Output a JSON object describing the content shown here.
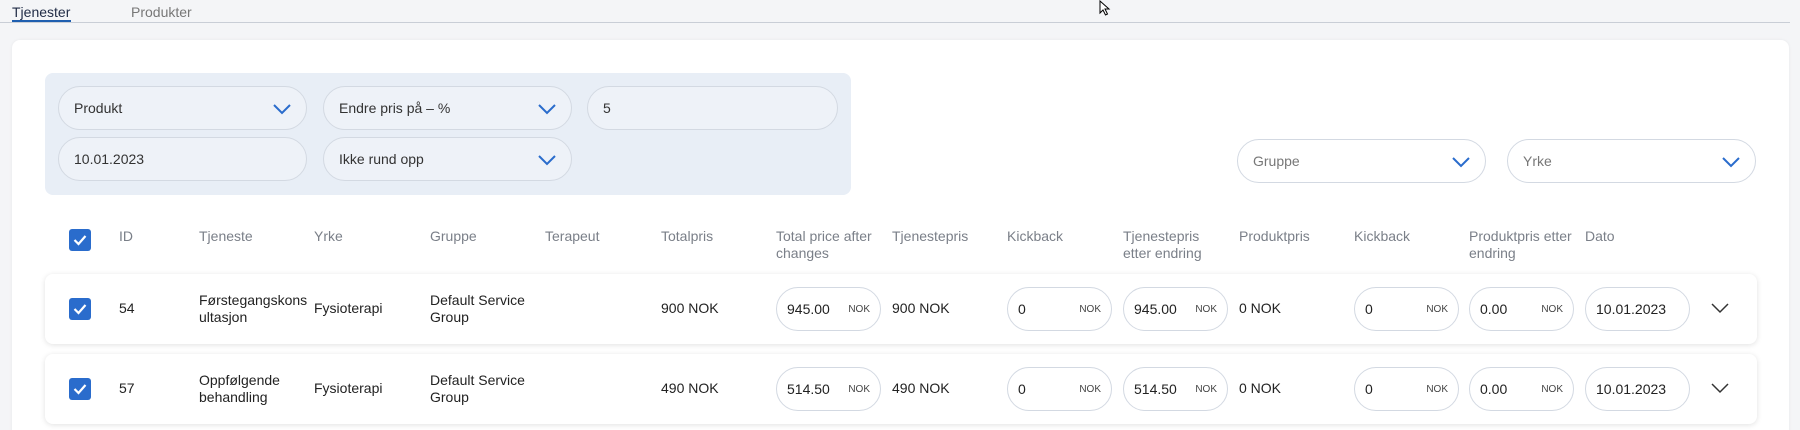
{
  "tabs": [
    {
      "label": "Tjenester",
      "active": true
    },
    {
      "label": "Produkter",
      "active": false
    }
  ],
  "filters": {
    "type_select": "Produkt",
    "price_mode_select": "Endre pris på – %",
    "percent_value": "5",
    "date_value": "10.01.2023",
    "rounding_select": "Ikke rund opp"
  },
  "right_filters": {
    "group_placeholder": "Gruppe",
    "profession_placeholder": "Yrke"
  },
  "table": {
    "headers": {
      "id": "ID",
      "service": "Tjeneste",
      "profession": "Yrke",
      "group": "Gruppe",
      "therapist": "Terapeut",
      "total_price": "Totalpris",
      "total_after_l1": "Total price after",
      "total_after_l2": "changes",
      "service_price": "Tjenestepris",
      "kickback": "Kickback",
      "service_after_l1": "Tjenestepris",
      "service_after_l2": "etter endring",
      "product_price": "Produktpris",
      "kickback2": "Kickback",
      "product_after_l1": "Produktpris etter",
      "product_after_l2": "endring",
      "date": "Dato"
    },
    "rows": [
      {
        "checked": true,
        "id": "54",
        "service_l1": "Førstegangskons",
        "service_l2": "ultasjon",
        "profession": "Fysioterapi",
        "group_l1": "Default Service",
        "group_l2": "Group",
        "total_price": "900 NOK",
        "total_after": "945.00",
        "service_price": "900 NOK",
        "kickback": "0",
        "service_after": "945.00",
        "product_price": "0 NOK",
        "kickback2": "0",
        "product_after": "0.00",
        "date": "10.01.2023",
        "unit": "NOK"
      },
      {
        "checked": true,
        "id": "57",
        "service_l1": "Oppfølgende",
        "service_l2": "behandling",
        "profession": "Fysioterapi",
        "group_l1": "Default Service",
        "group_l2": "Group",
        "total_price": "490 NOK",
        "total_after": "514.50",
        "service_price": "490 NOK",
        "kickback": "0",
        "service_after": "514.50",
        "product_price": "0 NOK",
        "kickback2": "0",
        "product_after": "0.00",
        "date": "10.01.2023",
        "unit": "NOK"
      }
    ]
  },
  "colors": {
    "accent": "#2a6ccc",
    "panel": "#e8eef6"
  }
}
